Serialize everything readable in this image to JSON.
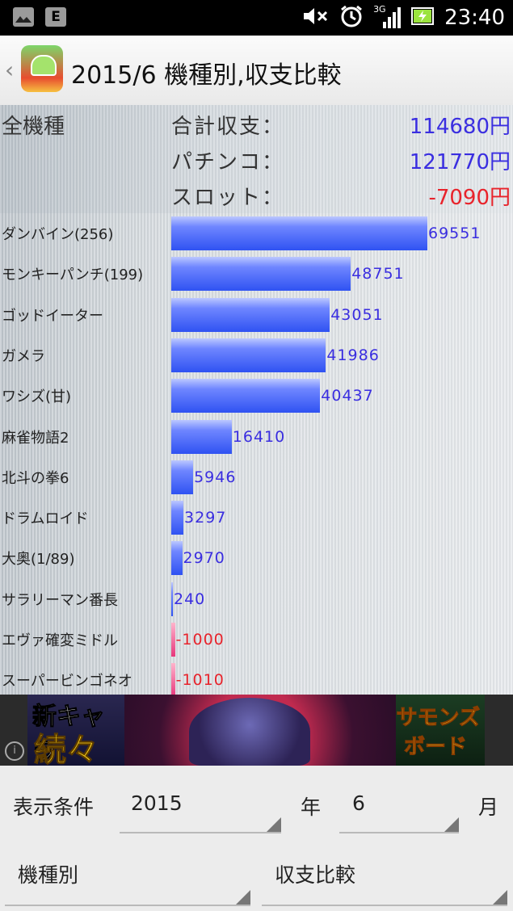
{
  "status_bar": {
    "icons_left": [
      "image-icon",
      "e-network-icon"
    ],
    "network_label": "E",
    "icons_right": [
      "mute-icon",
      "alarm-icon",
      "signal-3g-icon",
      "battery-icon"
    ],
    "network_type": "3G",
    "time": "23:40"
  },
  "action_bar": {
    "title": "2015/6 機種別,収支比較"
  },
  "summary": {
    "category": "全機種",
    "rows": [
      {
        "label": "合計収支：",
        "value": "114680円",
        "color": "#3a2ee0"
      },
      {
        "label": "パチンコ：",
        "value": "121770円",
        "color": "#3a2ee0"
      },
      {
        "label": "スロット：",
        "value": "-7090円",
        "color": "#e8232b"
      }
    ]
  },
  "chart_data": {
    "type": "bar",
    "orientation": "horizontal",
    "categories": [
      "ダンバイン(256)",
      "モンキーパンチ(199)",
      "ゴッドイーター",
      "ガメラ",
      "ワシズ(甘)",
      "麻雀物語2",
      "北斗の拳6",
      "ドラムロイド",
      "大奥(1/89)",
      "サラリーマン番長",
      "エヴァ確変ミドル",
      "スーパービンゴネオ"
    ],
    "values": [
      69551,
      48751,
      43051,
      41986,
      40437,
      16410,
      5946,
      3297,
      2970,
      240,
      -1000,
      -1010
    ],
    "positive_color": "#3a2ee0",
    "negative_color": "#e8232b"
  },
  "ad": {
    "headline_1": "新キャラ",
    "headline_2": "続々",
    "logo_1": "サモンズ",
    "logo_2": "ボード"
  },
  "controls": {
    "condition_label": "表示条件",
    "year_value": "2015",
    "year_unit": "年",
    "month_value": "6",
    "month_unit": "月",
    "group_value": "機種別",
    "compare_value": "収支比較"
  }
}
